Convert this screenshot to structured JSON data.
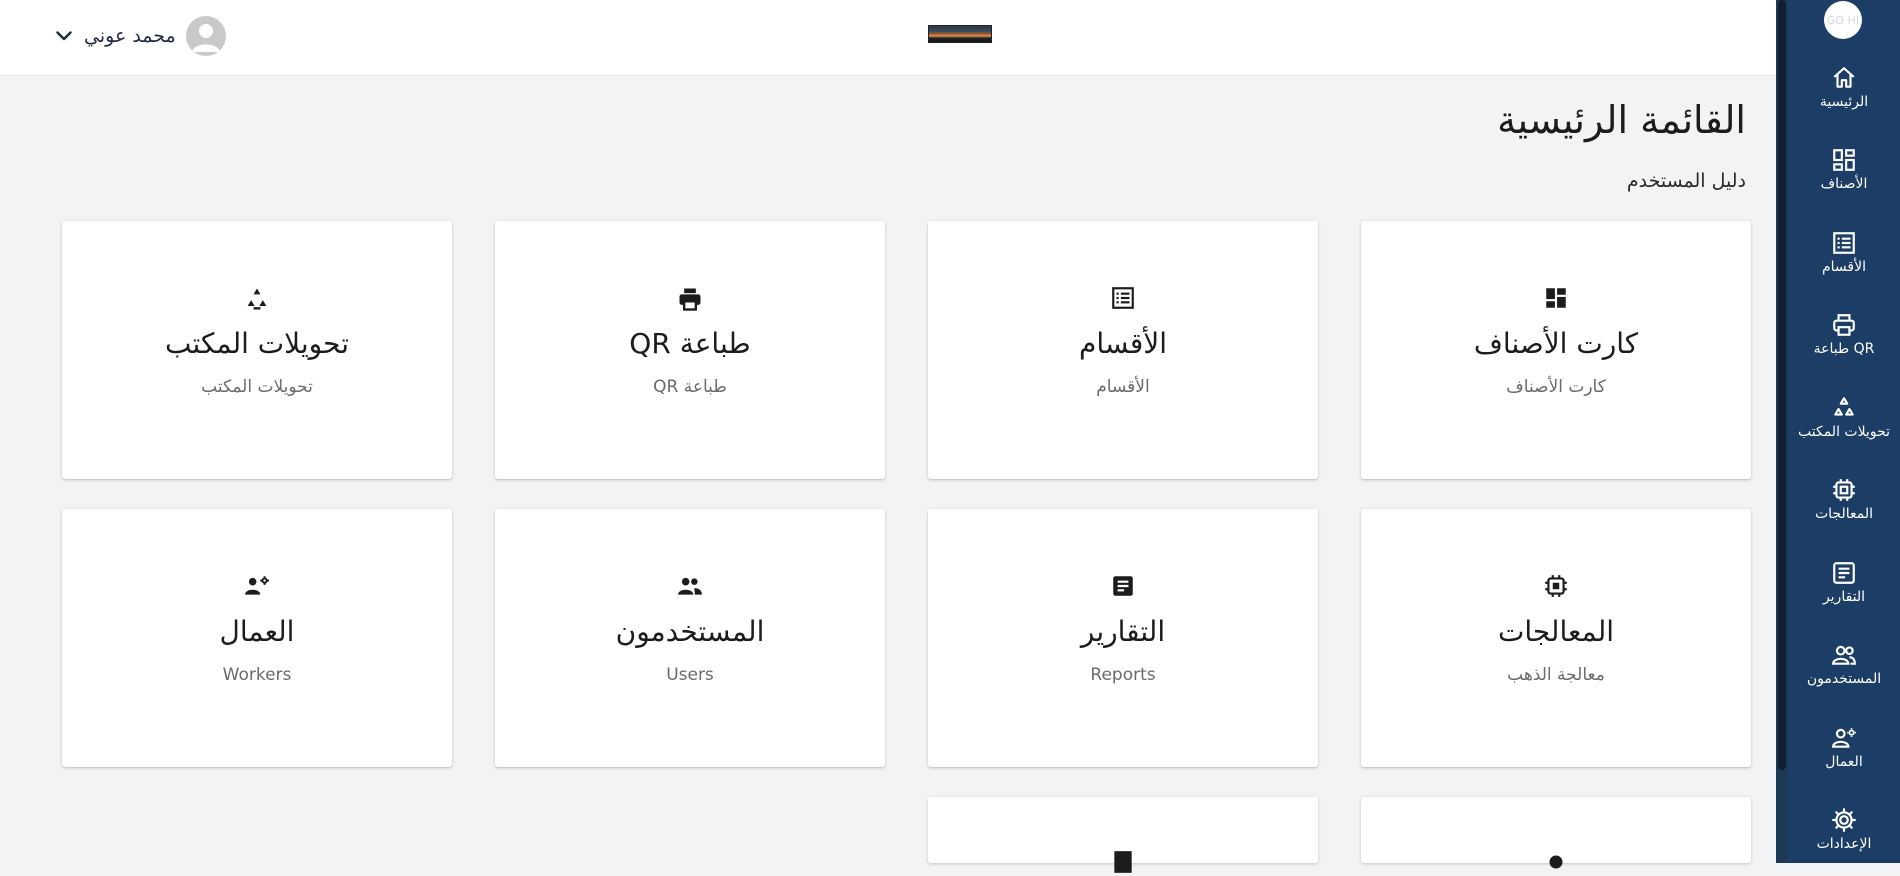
{
  "header": {
    "user_name": "محمد عوني",
    "brand_text": "GO HI"
  },
  "main": {
    "title": "القائمة الرئيسية",
    "guide_link": "دليل المستخدم"
  },
  "cards": [
    {
      "title": "كارت الأصناف",
      "subtitle": "كارت الأصناف",
      "icon": "dashboard-icon"
    },
    {
      "title": "الأقسام",
      "subtitle": "الأقسام",
      "icon": "list-icon"
    },
    {
      "title": "طباعة QR",
      "subtitle": "طباعة QR",
      "icon": "printer-icon"
    },
    {
      "title": "تحويلات المكتب",
      "subtitle": "تحويلات المكتب",
      "icon": "recycle-icon"
    },
    {
      "title": "المعالجات",
      "subtitle": "معالجة الذهب",
      "icon": "chip-icon"
    },
    {
      "title": "التقارير",
      "subtitle": "Reports",
      "icon": "report-icon"
    },
    {
      "title": "المستخدمون",
      "subtitle": "Users",
      "icon": "users-icon"
    },
    {
      "title": "العمال",
      "subtitle": "Workers",
      "icon": "workers-icon"
    }
  ],
  "sidebar": {
    "items": [
      {
        "label": "الرئيسية",
        "icon": "home-icon"
      },
      {
        "label": "الأصناف",
        "icon": "grid-icon"
      },
      {
        "label": "الأقسام",
        "icon": "list-icon"
      },
      {
        "label": "طباعة QR",
        "icon": "printer-icon"
      },
      {
        "label": "تحويلات المكتب",
        "icon": "recycle-icon"
      },
      {
        "label": "المعالجات",
        "icon": "chip-icon"
      },
      {
        "label": "التقارير",
        "icon": "report-icon"
      },
      {
        "label": "المستخدمون",
        "icon": "users-icon"
      },
      {
        "label": "العمال",
        "icon": "workers-icon"
      },
      {
        "label": "الإعدادات",
        "icon": "gear-icon"
      }
    ]
  },
  "colors": {
    "rail_bg": "#1c3d66",
    "page_bg": "#f2f3f5",
    "card_bg": "#ffffff"
  }
}
